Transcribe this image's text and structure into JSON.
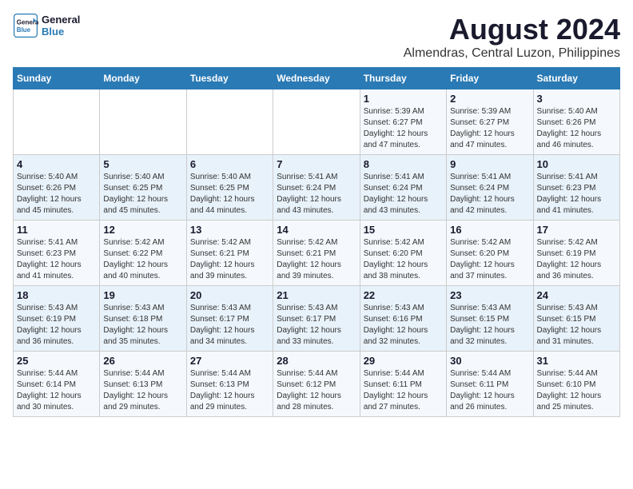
{
  "header": {
    "logo_line1": "General",
    "logo_line2": "Blue",
    "title": "August 2024",
    "subtitle": "Almendras, Central Luzon, Philippines"
  },
  "weekdays": [
    "Sunday",
    "Monday",
    "Tuesday",
    "Wednesday",
    "Thursday",
    "Friday",
    "Saturday"
  ],
  "weeks": [
    [
      {
        "day": "",
        "info": ""
      },
      {
        "day": "",
        "info": ""
      },
      {
        "day": "",
        "info": ""
      },
      {
        "day": "",
        "info": ""
      },
      {
        "day": "1",
        "info": "Sunrise: 5:39 AM\nSunset: 6:27 PM\nDaylight: 12 hours\nand 47 minutes."
      },
      {
        "day": "2",
        "info": "Sunrise: 5:39 AM\nSunset: 6:27 PM\nDaylight: 12 hours\nand 47 minutes."
      },
      {
        "day": "3",
        "info": "Sunrise: 5:40 AM\nSunset: 6:26 PM\nDaylight: 12 hours\nand 46 minutes."
      }
    ],
    [
      {
        "day": "4",
        "info": "Sunrise: 5:40 AM\nSunset: 6:26 PM\nDaylight: 12 hours\nand 45 minutes."
      },
      {
        "day": "5",
        "info": "Sunrise: 5:40 AM\nSunset: 6:25 PM\nDaylight: 12 hours\nand 45 minutes."
      },
      {
        "day": "6",
        "info": "Sunrise: 5:40 AM\nSunset: 6:25 PM\nDaylight: 12 hours\nand 44 minutes."
      },
      {
        "day": "7",
        "info": "Sunrise: 5:41 AM\nSunset: 6:24 PM\nDaylight: 12 hours\nand 43 minutes."
      },
      {
        "day": "8",
        "info": "Sunrise: 5:41 AM\nSunset: 6:24 PM\nDaylight: 12 hours\nand 43 minutes."
      },
      {
        "day": "9",
        "info": "Sunrise: 5:41 AM\nSunset: 6:24 PM\nDaylight: 12 hours\nand 42 minutes."
      },
      {
        "day": "10",
        "info": "Sunrise: 5:41 AM\nSunset: 6:23 PM\nDaylight: 12 hours\nand 41 minutes."
      }
    ],
    [
      {
        "day": "11",
        "info": "Sunrise: 5:41 AM\nSunset: 6:23 PM\nDaylight: 12 hours\nand 41 minutes."
      },
      {
        "day": "12",
        "info": "Sunrise: 5:42 AM\nSunset: 6:22 PM\nDaylight: 12 hours\nand 40 minutes."
      },
      {
        "day": "13",
        "info": "Sunrise: 5:42 AM\nSunset: 6:21 PM\nDaylight: 12 hours\nand 39 minutes."
      },
      {
        "day": "14",
        "info": "Sunrise: 5:42 AM\nSunset: 6:21 PM\nDaylight: 12 hours\nand 39 minutes."
      },
      {
        "day": "15",
        "info": "Sunrise: 5:42 AM\nSunset: 6:20 PM\nDaylight: 12 hours\nand 38 minutes."
      },
      {
        "day": "16",
        "info": "Sunrise: 5:42 AM\nSunset: 6:20 PM\nDaylight: 12 hours\nand 37 minutes."
      },
      {
        "day": "17",
        "info": "Sunrise: 5:42 AM\nSunset: 6:19 PM\nDaylight: 12 hours\nand 36 minutes."
      }
    ],
    [
      {
        "day": "18",
        "info": "Sunrise: 5:43 AM\nSunset: 6:19 PM\nDaylight: 12 hours\nand 36 minutes."
      },
      {
        "day": "19",
        "info": "Sunrise: 5:43 AM\nSunset: 6:18 PM\nDaylight: 12 hours\nand 35 minutes."
      },
      {
        "day": "20",
        "info": "Sunrise: 5:43 AM\nSunset: 6:17 PM\nDaylight: 12 hours\nand 34 minutes."
      },
      {
        "day": "21",
        "info": "Sunrise: 5:43 AM\nSunset: 6:17 PM\nDaylight: 12 hours\nand 33 minutes."
      },
      {
        "day": "22",
        "info": "Sunrise: 5:43 AM\nSunset: 6:16 PM\nDaylight: 12 hours\nand 32 minutes."
      },
      {
        "day": "23",
        "info": "Sunrise: 5:43 AM\nSunset: 6:15 PM\nDaylight: 12 hours\nand 32 minutes."
      },
      {
        "day": "24",
        "info": "Sunrise: 5:43 AM\nSunset: 6:15 PM\nDaylight: 12 hours\nand 31 minutes."
      }
    ],
    [
      {
        "day": "25",
        "info": "Sunrise: 5:44 AM\nSunset: 6:14 PM\nDaylight: 12 hours\nand 30 minutes."
      },
      {
        "day": "26",
        "info": "Sunrise: 5:44 AM\nSunset: 6:13 PM\nDaylight: 12 hours\nand 29 minutes."
      },
      {
        "day": "27",
        "info": "Sunrise: 5:44 AM\nSunset: 6:13 PM\nDaylight: 12 hours\nand 29 minutes."
      },
      {
        "day": "28",
        "info": "Sunrise: 5:44 AM\nSunset: 6:12 PM\nDaylight: 12 hours\nand 28 minutes."
      },
      {
        "day": "29",
        "info": "Sunrise: 5:44 AM\nSunset: 6:11 PM\nDaylight: 12 hours\nand 27 minutes."
      },
      {
        "day": "30",
        "info": "Sunrise: 5:44 AM\nSunset: 6:11 PM\nDaylight: 12 hours\nand 26 minutes."
      },
      {
        "day": "31",
        "info": "Sunrise: 5:44 AM\nSunset: 6:10 PM\nDaylight: 12 hours\nand 25 minutes."
      }
    ]
  ]
}
